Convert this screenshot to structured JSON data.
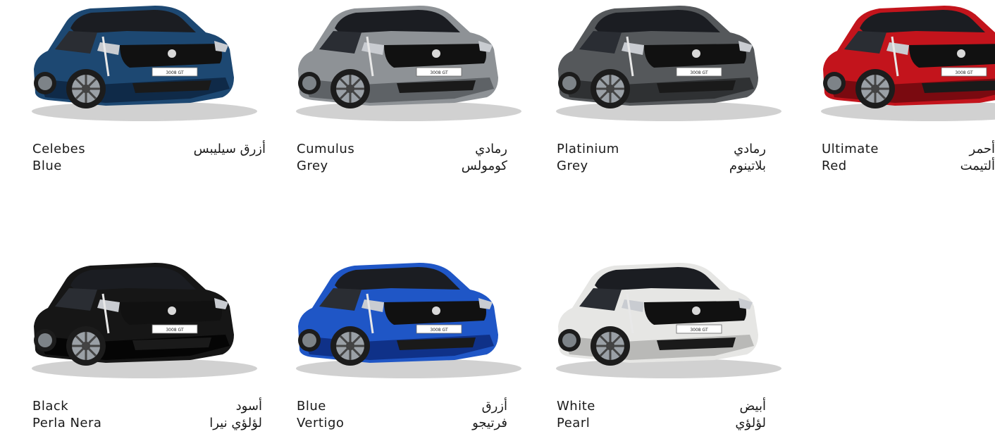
{
  "colors": [
    {
      "en1": "Celebes",
      "en2": "Blue",
      "ar1": "أزرق سيليبس",
      "ar2": "",
      "body": "#1d4872",
      "body_dark": "#0f2a48"
    },
    {
      "en1": "Cumulus",
      "en2": "Grey",
      "ar1": "رمادي",
      "ar2": "كومولس",
      "body": "#8e9296",
      "body_dark": "#5e6266"
    },
    {
      "en1": "Platinium",
      "en2": "Grey",
      "ar1": "رمادي",
      "ar2": "بلاتينوم",
      "body": "#55585b",
      "body_dark": "#2f3133"
    },
    {
      "en1": "Ultimate",
      "en2": "Red",
      "ar1": "أحمر",
      "ar2": "ألتيمت",
      "body": "#c3141c",
      "body_dark": "#7a0a10"
    },
    {
      "en1": "Black",
      "en2": "Perla Nera",
      "ar1": "أسود",
      "ar2": "لؤلؤي نيرا",
      "body": "#161616",
      "body_dark": "#050505"
    },
    {
      "en1": "Blue",
      "en2": "Vertigo",
      "ar1": "أزرق",
      "ar2": "فرتيجو",
      "body": "#1f56c6",
      "body_dark": "#0f3188"
    },
    {
      "en1": "White",
      "en2": "Pearl",
      "ar1": "أبيض",
      "ar2": "لؤلؤي",
      "body": "#e6e6e4",
      "body_dark": "#b9b9b7"
    }
  ],
  "plate_text": "3008 GT"
}
